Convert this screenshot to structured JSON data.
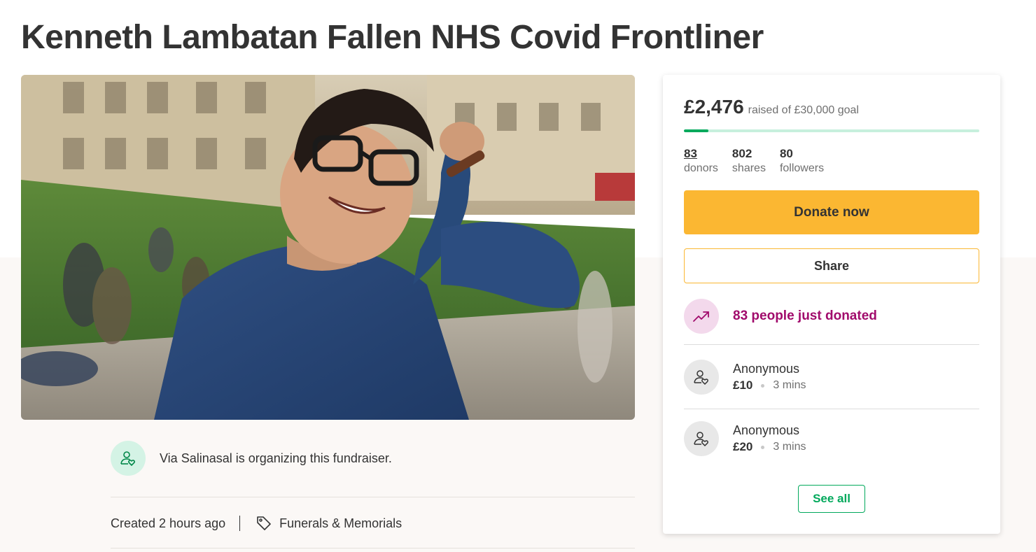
{
  "campaign": {
    "title": "Kenneth Lambatan Fallen NHS Covid Frontliner",
    "organizer_text": "Via Salinasal is organizing this fundraiser.",
    "created": "Created 2 hours ago",
    "category": "Funerals & Memorials"
  },
  "donation_card": {
    "raised_amount": "£2,476",
    "raised_goal_text": "raised of £30,000 goal",
    "progress_fraction": 0.0825,
    "stats": [
      {
        "value": "83",
        "label": "donors"
      },
      {
        "value": "802",
        "label": "shares"
      },
      {
        "value": "80",
        "label": "followers"
      }
    ],
    "donate_label": "Donate now",
    "share_label": "Share",
    "trend_text": "83 people just donated",
    "donations": [
      {
        "name": "Anonymous",
        "amount": "£10",
        "time": "3 mins"
      },
      {
        "name": "Anonymous",
        "amount": "£20",
        "time": "3 mins"
      }
    ],
    "see_all_label": "See all"
  },
  "colors": {
    "accent_green": "#02a95c",
    "donate_yellow": "#fbb732",
    "trend_purple": "#a10b6c",
    "text_dark": "#333333"
  },
  "icons": {
    "organizer": "person-heart-icon",
    "category": "tag-icon",
    "trend": "trending-up-icon",
    "donor": "person-heart-icon"
  }
}
